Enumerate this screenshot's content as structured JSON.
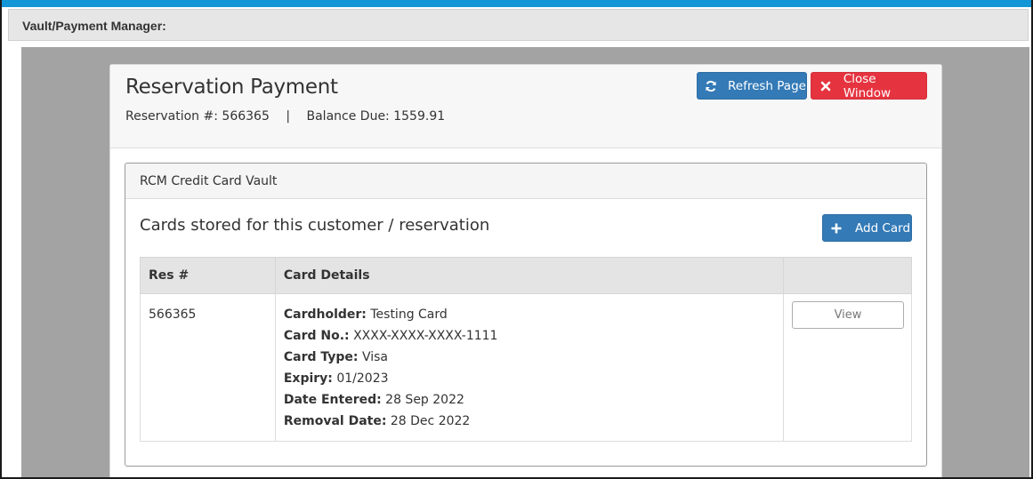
{
  "window": {
    "title": "Vault/Payment Manager:"
  },
  "header": {
    "title": "Reservation Payment",
    "reservation_label": "Reservation #:",
    "reservation_number": "566365",
    "separator": "|",
    "balance_label": "Balance Due:",
    "balance_value": "1559.91",
    "refresh_label": "Refresh Page",
    "close_label": "Close Window"
  },
  "vault": {
    "title": "RCM Credit Card Vault",
    "cards_heading": "Cards stored for this customer / reservation",
    "add_card_label": "Add Card",
    "columns": [
      "Res #",
      "Card Details",
      ""
    ],
    "rows": [
      {
        "res": "566365",
        "details": [
          {
            "label": "Cardholder:",
            "value": "Testing Card"
          },
          {
            "label": "Card No.:",
            "value": "XXXX-XXXX-XXXX-1111"
          },
          {
            "label": "Card Type:",
            "value": "Visa"
          },
          {
            "label": "Expiry:",
            "value": "01/2023"
          },
          {
            "label": "Date Entered:",
            "value": "28 Sep 2022"
          },
          {
            "label": "Removal Date:",
            "value": "28 Dec 2022"
          }
        ],
        "action_label": "View"
      }
    ]
  },
  "colors": {
    "topbar": "#1296d6",
    "primary": "#337ab7",
    "danger": "#e5343f",
    "backdrop": "#a3a3a3"
  },
  "icons": {
    "refresh": "refresh-icon",
    "close": "close-icon",
    "add": "plus-icon"
  }
}
